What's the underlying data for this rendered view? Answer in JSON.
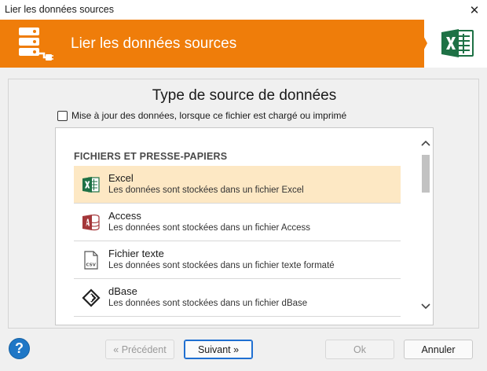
{
  "window": {
    "title": "Lier les données sources",
    "close_glyph": "✕"
  },
  "banner": {
    "heading": "Lier les données sources",
    "accent_color": "#ef7d0a"
  },
  "main": {
    "title": "Type de source de données",
    "checkbox_label": "Mise à jour des données, lorsque ce fichier est chargé ou imprimé",
    "checkbox_checked": false
  },
  "list": {
    "section_header": "FICHIERS ET PRESSE-PAPIERS",
    "items": [
      {
        "name": "Excel",
        "description": "Les données sont stockées dans un fichier Excel",
        "icon": "excel-icon",
        "selected": true
      },
      {
        "name": "Access",
        "description": "Les données sont stockées dans un fichier Access",
        "icon": "access-icon",
        "selected": false
      },
      {
        "name": "Fichier texte",
        "description": "Les données sont stockées dans un fichier texte formaté",
        "icon": "csv-file-icon",
        "selected": false
      },
      {
        "name": "dBase",
        "description": "Les données sont stockées dans un fichier dBase",
        "icon": "dbase-icon",
        "selected": false
      }
    ],
    "selected_color": "#fde8c4"
  },
  "footer": {
    "help_glyph": "?",
    "previous_label": "« Précédent",
    "next_label": "Suivant »",
    "ok_label": "Ok",
    "cancel_label": "Annuler"
  }
}
